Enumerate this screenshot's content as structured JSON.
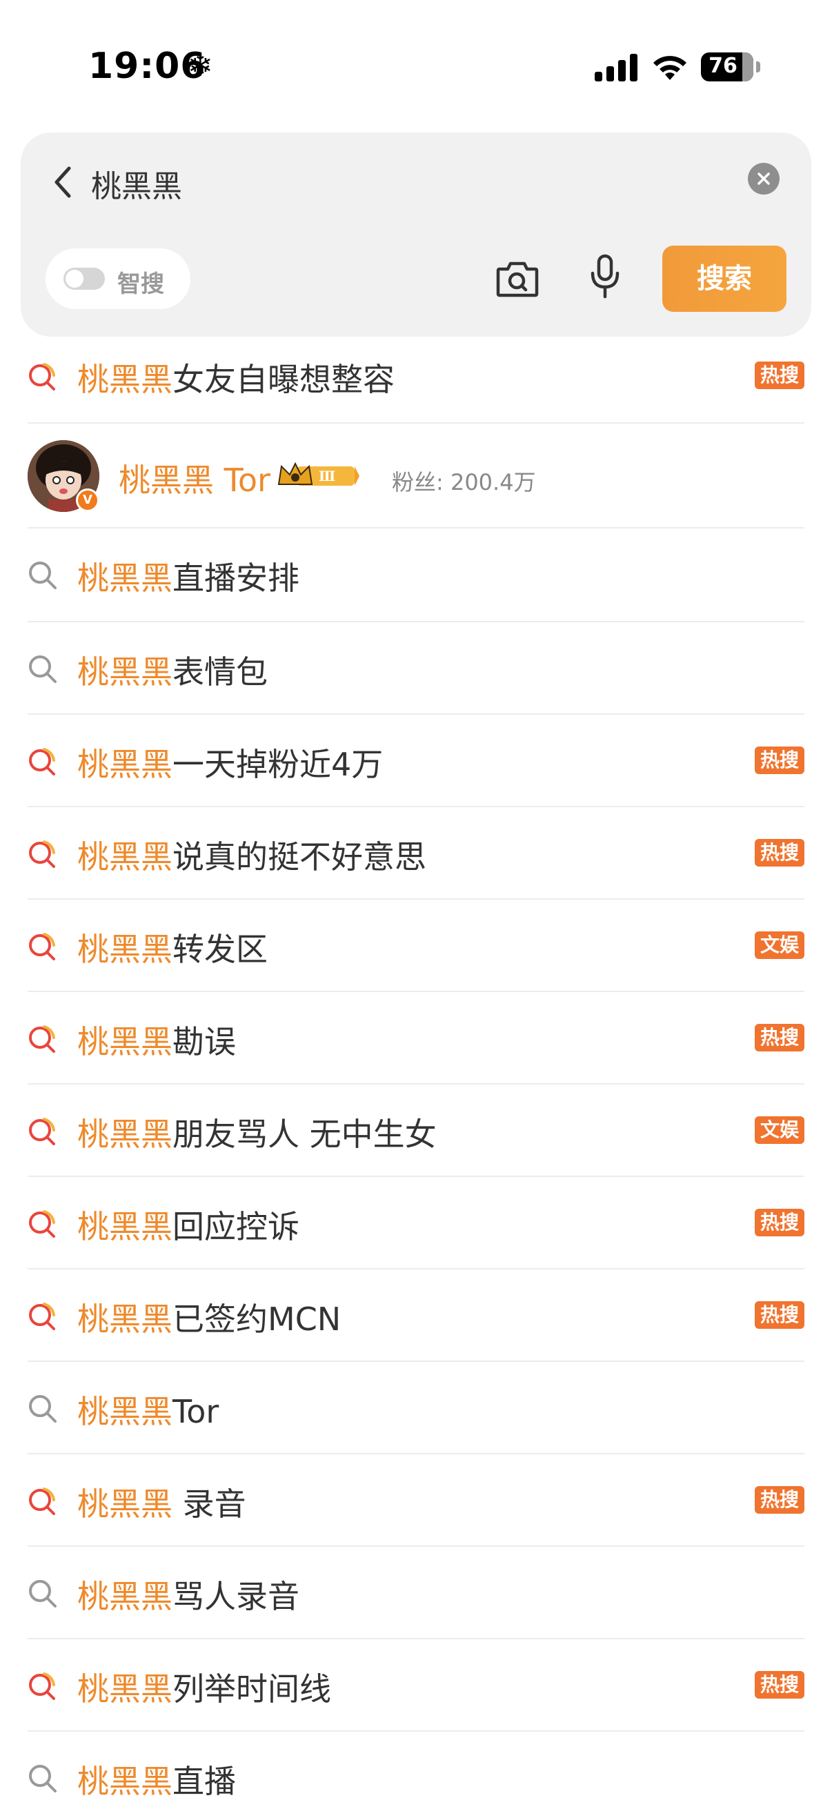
{
  "status_bar": {
    "time": "19:06",
    "battery": "76",
    "snow_glyph": "❄"
  },
  "search": {
    "query": "桃黑黑",
    "smart_label": "智搜",
    "button_label": "搜索",
    "icons": [
      "back-icon",
      "clear-icon",
      "camera-icon",
      "microphone-icon"
    ]
  },
  "user_result": {
    "name": "桃黑黑 Tor",
    "level_badge": "Ⅲ",
    "fans": "粉丝: 200.4万",
    "accent": "#ee8a2c"
  },
  "suggestions": [
    {
      "highlight": "桃黑黑",
      "rest": "女友自曝想整容",
      "badge": "热搜",
      "hot": true
    },
    {
      "highlight": "桃黑黑",
      "rest": "直播安排",
      "badge": "",
      "hot": false
    },
    {
      "highlight": "桃黑黑",
      "rest": "表情包",
      "badge": "",
      "hot": false
    },
    {
      "highlight": "桃黑黑",
      "rest": "一天掉粉近4万",
      "badge": "热搜",
      "hot": true
    },
    {
      "highlight": "桃黑黑",
      "rest": "说真的挺不好意思",
      "badge": "热搜",
      "hot": true
    },
    {
      "highlight": "桃黑黑",
      "rest": "转发区",
      "badge": "文娱",
      "hot": true
    },
    {
      "highlight": "桃黑黑",
      "rest": "勘误",
      "badge": "热搜",
      "hot": true
    },
    {
      "highlight": "桃黑黑",
      "rest": "朋友骂人 无中生女",
      "badge": "文娱",
      "hot": true
    },
    {
      "highlight": "桃黑黑",
      "rest": "回应控诉",
      "badge": "热搜",
      "hot": true
    },
    {
      "highlight": "桃黑黑",
      "rest": "已签约MCN",
      "badge": "热搜",
      "hot": true
    },
    {
      "highlight": "桃黑黑",
      "rest": "Tor",
      "badge": "",
      "hot": false
    },
    {
      "highlight": "桃黑黑",
      "rest": " 录音",
      "badge": "热搜",
      "hot": true
    },
    {
      "highlight": "桃黑黑",
      "rest": "骂人录音",
      "badge": "",
      "hot": false
    },
    {
      "highlight": "桃黑黑",
      "rest": "列举时间线",
      "badge": "热搜",
      "hot": true
    },
    {
      "highlight": "桃黑黑",
      "rest": "直播",
      "badge": "",
      "hot": false
    }
  ],
  "colors": {
    "highlight": "#ee8a2c",
    "badge": "#f0742f",
    "search_button": "#f29b3a"
  }
}
